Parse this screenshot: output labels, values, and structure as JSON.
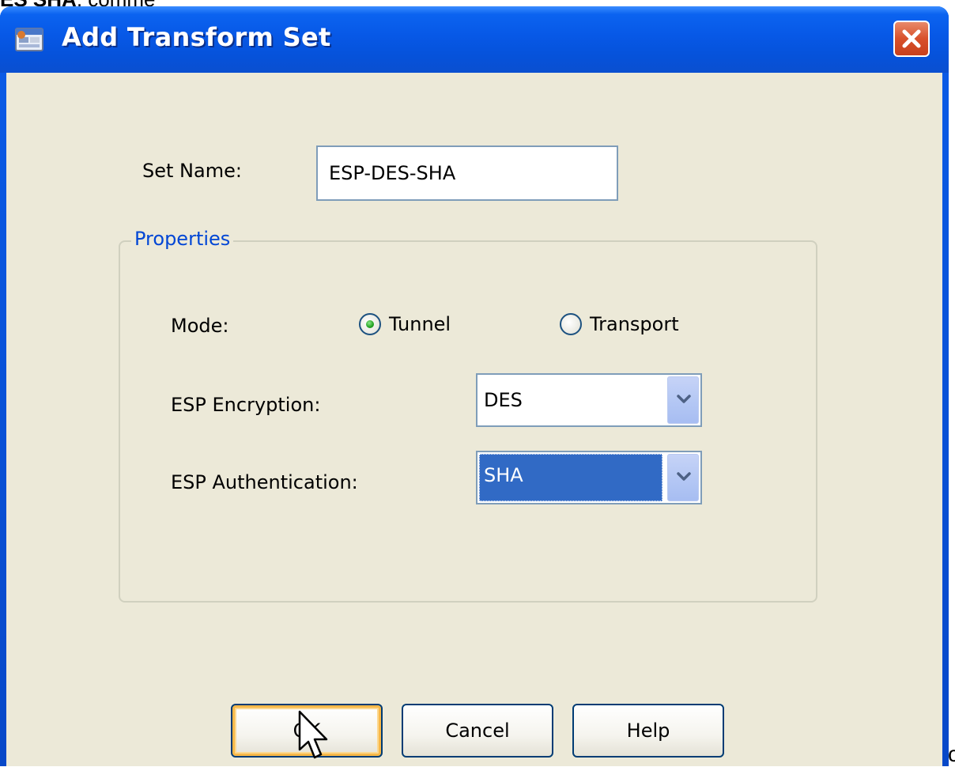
{
  "page": {
    "top_crop_bold": "ES SHA",
    "top_crop_rest": ", comme",
    "right_crop_text": "c"
  },
  "window": {
    "title": "Add Transform Set",
    "icon": "transform-set-app-icon",
    "close_icon": "close-x-icon"
  },
  "form": {
    "set_name_label": "Set Name:",
    "set_name_value": "ESP-DES-SHA",
    "properties_title": "Properties",
    "mode_label": "Mode:",
    "mode_options": [
      {
        "label": "Tunnel",
        "selected": true
      },
      {
        "label": "Transport",
        "selected": false
      }
    ],
    "encryption_label": "ESP Encryption:",
    "encryption_value": "DES",
    "authentication_label": "ESP Authentication:",
    "authentication_value": "SHA",
    "dropdown_icon": "chevron-down-icon"
  },
  "buttons": {
    "ok": "OK",
    "cancel": "Cancel",
    "help": "Help"
  },
  "colors": {
    "titlebar": "#0758e6",
    "dialog_bg": "#ece9d8",
    "group_title": "#0046d5",
    "selection": "#316ac5",
    "close_button": "#d8502a"
  }
}
